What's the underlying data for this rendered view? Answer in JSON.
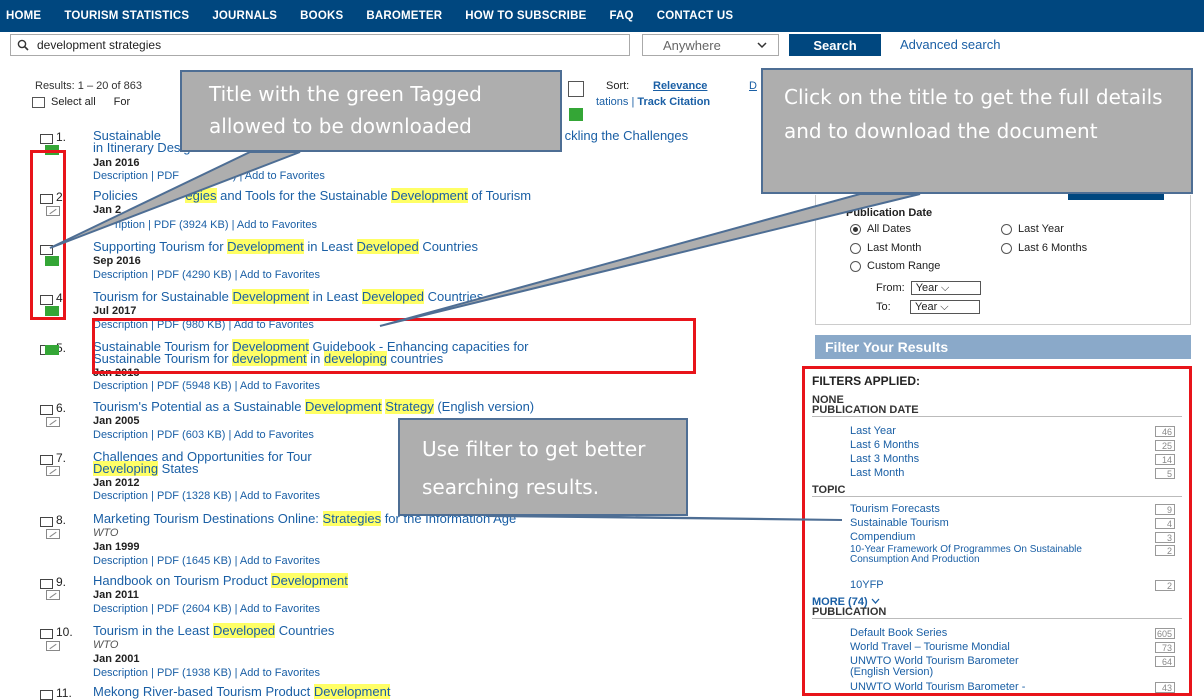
{
  "nav": [
    "HOME",
    "TOURISM STATISTICS",
    "JOURNALS",
    "BOOKS",
    "BAROMETER",
    "HOW TO SUBSCRIBE",
    "FAQ",
    "CONTACT US"
  ],
  "search": {
    "query": "development strategies",
    "scope": "Anywhere",
    "button": "Search",
    "advanced": "Advanced search"
  },
  "results_count": "Results: 1 – 20 of 863",
  "select_all": "Select all",
  "for_label": "For",
  "sort": {
    "label": "Sort:",
    "relevance": "Relevance",
    "d": "D"
  },
  "track": {
    "prefix": "tations | ",
    "bold": "Track Citation"
  },
  "items": [
    {
      "num": "1.",
      "title_html": "Sustainable Tourism Product Development ... ckling the Challenges in Itinerary Design ... Field",
      "date": "Jan 2016",
      "desc": "Description | PDF (... KB) | Add to Favorites"
    },
    {
      "num": "2.",
      "date": "Jan 2015",
      "desc": "Description | PDF (3924 KB) | Add to Favorites"
    },
    {
      "num": "3.",
      "date": "Sep 2016",
      "desc": "Description | PDF (4290 KB) | Add to Favorites"
    },
    {
      "num": "4.",
      "date": "Jul 2017",
      "desc": "Description | PDF (980 KB) | Add to Favorites"
    },
    {
      "num": "5.",
      "date": "Jan 2013",
      "desc": "Description | PDF (5948 KB) | Add to Favorites"
    },
    {
      "num": "6.",
      "date": "Jan 2005",
      "desc": "Description | PDF (603 KB) | Add to Favorites"
    },
    {
      "num": "7.",
      "date": "Jan 2012",
      "desc": "Description | PDF (1328 KB) | Add to Favorites"
    },
    {
      "num": "8.",
      "author": "WTO",
      "date": "Jan 1999",
      "desc": "Description | PDF (1645 KB) | Add to Favorites"
    },
    {
      "num": "9.",
      "date": "Jan 2011",
      "desc": "Description | PDF (2604 KB) | Add to Favorites"
    },
    {
      "num": "10.",
      "author": "WTO",
      "date": "Jan 2001",
      "desc": "Description | PDF (1938 KB) | Add to Favorites"
    },
    {
      "num": "11."
    }
  ],
  "callouts": {
    "c1": "Title with the green Tagged allowed to be downloaded",
    "c2": "Click on the title to get the full details and to download the document",
    "c3": "Use filter to get better searching results."
  },
  "pubdate": {
    "title": "Publication Date",
    "opts": [
      "All Dates",
      "Last Year",
      "Last Month",
      "Last 6 Months",
      "Custom Range"
    ],
    "from": "From:",
    "to": "To:",
    "year": "Year"
  },
  "filter": {
    "head": "Filter Your Results",
    "applied": "FILTERS APPLIED:",
    "none": "NONE",
    "pubdate": "PUBLICATION DATE",
    "pd_items": [
      {
        "l": "Last Year",
        "c": "46"
      },
      {
        "l": "Last 6 Months",
        "c": "25"
      },
      {
        "l": "Last 3 Months",
        "c": "14"
      },
      {
        "l": "Last Month",
        "c": "5"
      }
    ],
    "topic": "TOPIC",
    "topic_items": [
      {
        "l": "Tourism Forecasts",
        "c": "9"
      },
      {
        "l": "Sustainable Tourism",
        "c": "4"
      },
      {
        "l": "Compendium",
        "c": "3"
      },
      {
        "l": "10-Year Framework Of Programmes On Sustainable Consumption And Production",
        "c": "2"
      },
      {
        "l": "10YFP",
        "c": "2"
      }
    ],
    "more": "MORE (74)",
    "publication": "PUBLICATION",
    "pub_items": [
      {
        "l": "Default Book Series",
        "c": "605"
      },
      {
        "l": "World Travel – Tourisme Mondial",
        "c": "73"
      },
      {
        "l": "UNWTO World Tourism Barometer (English Version)",
        "c": "64"
      },
      {
        "l": "UNWTO World Tourism Barometer -",
        "c": "43"
      }
    ]
  }
}
